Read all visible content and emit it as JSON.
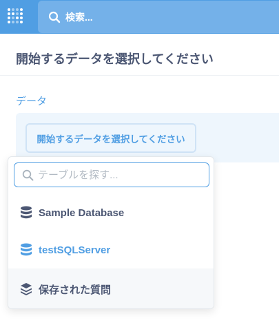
{
  "topbar": {
    "search_placeholder": "検索...",
    "brand_color": "#509ee3"
  },
  "page": {
    "title": "開始するデータを選択してください"
  },
  "step": {
    "section_label": "データ",
    "select_button_label": "開始するデータを選択してください"
  },
  "popover": {
    "search_placeholder": "テーブルを探す...",
    "items": [
      {
        "label": "Sample Database",
        "icon": "database-icon"
      },
      {
        "label": "testSQLServer",
        "icon": "database-icon",
        "color": "#509ee3"
      },
      {
        "label": "保存された質問",
        "icon": "stack-icon"
      }
    ]
  }
}
